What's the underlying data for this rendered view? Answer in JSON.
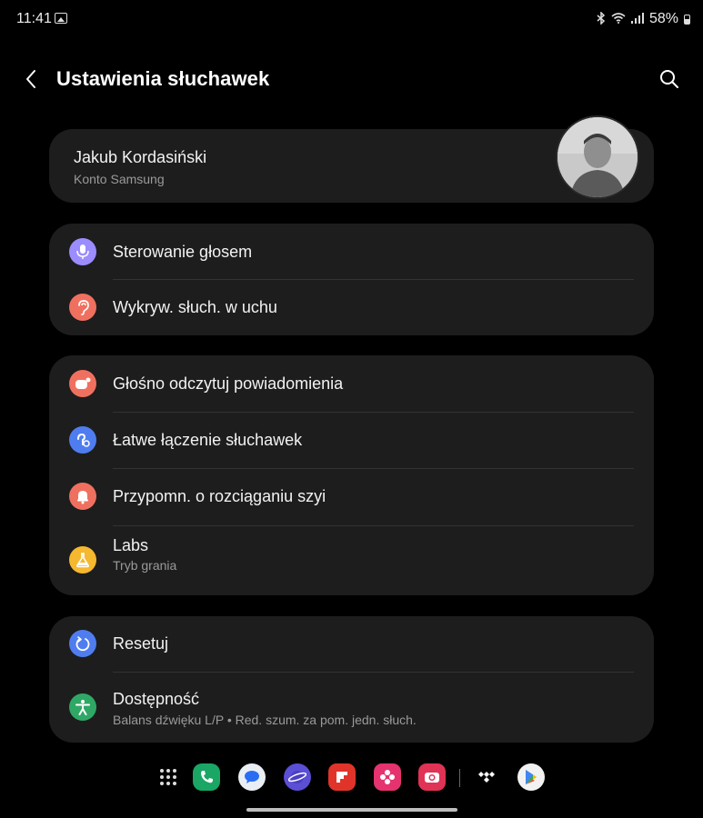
{
  "status_bar": {
    "time": "11:41",
    "battery": "58%",
    "icons": [
      "gallery-icon",
      "bluetooth-icon",
      "wifi-icon",
      "signal-icon",
      "battery-icon"
    ]
  },
  "header": {
    "title": "Ustawienia słuchawek",
    "back_icon": "back-arrow-icon",
    "search_icon": "search-icon"
  },
  "profile": {
    "name": "Jakub Kordasiński",
    "account": "Konto Samsung"
  },
  "group1": {
    "items": [
      {
        "label": "Sterowanie głosem",
        "icon": "microphone-icon",
        "color": "#9b8cff"
      },
      {
        "label": "Wykryw. słuch. w uchu",
        "icon": "ear-icon",
        "color": "#f0705f"
      }
    ]
  },
  "group2": {
    "items": [
      {
        "label": "Głośno odczytuj powiadomienia",
        "icon": "notification-read-icon",
        "color": "#f0705f"
      },
      {
        "label": "Łatwe łączenie słuchawek",
        "icon": "easy-pairing-icon",
        "color": "#4f7df0"
      },
      {
        "label": "Przypomn. o rozciąganiu szyi",
        "icon": "bell-icon",
        "color": "#f0705f"
      },
      {
        "label": "Labs",
        "sublabel": "Tryb grania",
        "icon": "labs-flask-icon",
        "color": "#f5b82e"
      }
    ]
  },
  "group3": {
    "items": [
      {
        "label": "Resetuj",
        "icon": "reset-icon",
        "color": "#4f7df0"
      },
      {
        "label": "Dostępność",
        "sublabel": "Balans dźwięku L/P  •  Red. szum. za pom. jedn. słuch.",
        "icon": "accessibility-icon",
        "color": "#2fa866"
      }
    ]
  },
  "dock": {
    "apps": [
      "app-drawer-icon",
      "phone-app-icon",
      "messages-app-icon",
      "internet-app-icon",
      "flipboard-app-icon",
      "gallery-app-icon",
      "camera-app-icon",
      "tidal-app-icon",
      "play-store-app-icon"
    ]
  }
}
